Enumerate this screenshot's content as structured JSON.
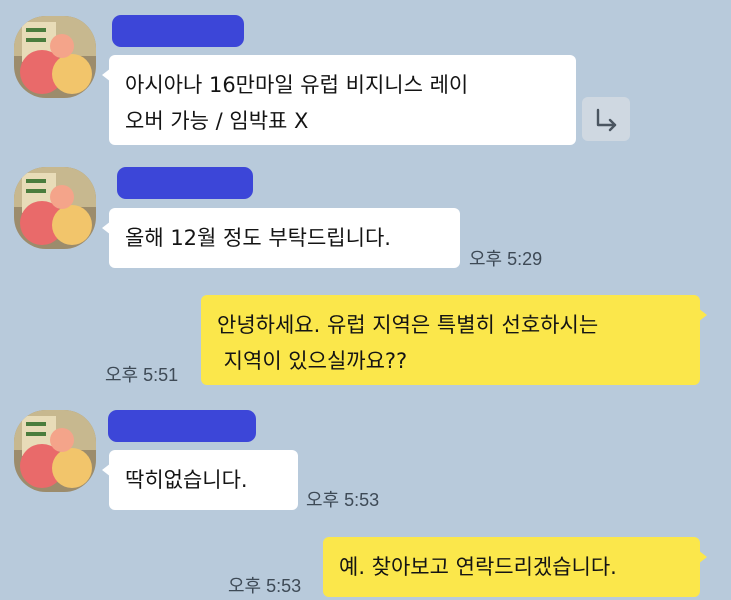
{
  "colors": {
    "background": "#b8cadb",
    "incoming_bubble": "#ffffff",
    "outgoing_bubble": "#fbe74b",
    "redaction": "#3c46d8"
  },
  "messages": [
    {
      "direction": "incoming",
      "sender_redacted": true,
      "lines": [
        "아시아나 16만마일 유럽 비지니스 레이",
        "오버 가능 / 임박표 X"
      ],
      "time": "",
      "share_icon": "forward-arrow-icon"
    },
    {
      "direction": "incoming",
      "sender_redacted": true,
      "lines": [
        "올해 12월 정도 부탁드립니다."
      ],
      "time": "오후 5:29"
    },
    {
      "direction": "outgoing",
      "lines": [
        "안녕하세요. 유럽 지역은 특별히 선호하시는",
        " 지역이 있으실까요??"
      ],
      "time": "오후 5:51"
    },
    {
      "direction": "incoming",
      "sender_redacted": true,
      "lines": [
        "딱히없습니다."
      ],
      "time": "오후 5:53"
    },
    {
      "direction": "outgoing",
      "lines": [
        "예. 찾아보고 연락드리겠습니다."
      ],
      "time": "오후 5:53"
    }
  ]
}
